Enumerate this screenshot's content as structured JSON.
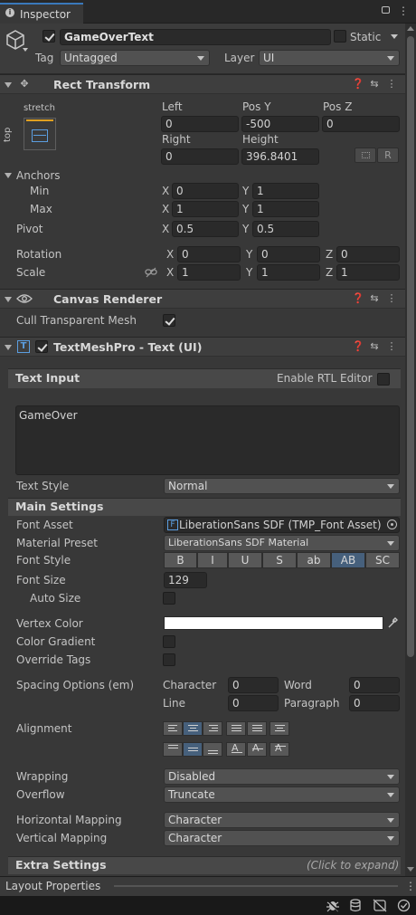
{
  "tab": {
    "label": "Inspector"
  },
  "object": {
    "name": "GameOverText",
    "static_label": "Static",
    "tag_label": "Tag",
    "tag_value": "Untagged",
    "layer_label": "Layer",
    "layer_value": "UI"
  },
  "rect_transform": {
    "title": "Rect Transform",
    "anchor_preset": {
      "h": "stretch",
      "v": "top"
    },
    "col_labels": {
      "left": "Left",
      "pos_y": "Pos Y",
      "pos_z": "Pos Z",
      "right": "Right",
      "height": "Height"
    },
    "values": {
      "left": "0",
      "pos_y": "-500",
      "pos_z": "0",
      "right": "0",
      "height": "396.8401"
    },
    "raw_btn": "R",
    "anchors_label": "Anchors",
    "min_label": "Min",
    "min_x": "0",
    "min_y": "1",
    "max_label": "Max",
    "max_x": "1",
    "max_y": "1",
    "pivot_label": "Pivot",
    "pivot_x": "0.5",
    "pivot_y": "0.5",
    "rotation_label": "Rotation",
    "rot_x": "0",
    "rot_y": "0",
    "rot_z": "0",
    "scale_label": "Scale",
    "scale_x": "1",
    "scale_y": "1",
    "scale_z": "1",
    "axis_x": "X",
    "axis_y": "Y",
    "axis_z": "Z"
  },
  "canvas_renderer": {
    "title": "Canvas Renderer",
    "cull_label": "Cull Transparent Mesh"
  },
  "tmp": {
    "title": "TextMeshPro - Text (UI)",
    "text_input_label": "Text Input",
    "rtl_label": "Enable RTL Editor",
    "text": "GameOver",
    "text_style_label": "Text Style",
    "text_style_value": "Normal",
    "main_settings": "Main Settings",
    "font_asset_label": "Font Asset",
    "font_asset_value": "LiberationSans SDF (TMP_Font Asset)",
    "material_label": "Material Preset",
    "material_value": "LiberationSans SDF Material",
    "font_style_label": "Font Style",
    "font_style_buttons": [
      "B",
      "I",
      "U",
      "S",
      "ab",
      "AB",
      "SC"
    ],
    "font_size_label": "Font Size",
    "font_size_value": "129",
    "auto_size_label": "Auto Size",
    "vertex_color_label": "Vertex Color",
    "color_gradient_label": "Color Gradient",
    "override_tags_label": "Override Tags",
    "spacing_label": "Spacing Options (em)",
    "character_label": "Character",
    "character_value": "0",
    "word_label": "Word",
    "word_value": "0",
    "line_label": "Line",
    "line_value": "0",
    "paragraph_label": "Paragraph",
    "paragraph_value": "0",
    "alignment_label": "Alignment",
    "wrapping_label": "Wrapping",
    "wrapping_value": "Disabled",
    "overflow_label": "Overflow",
    "overflow_value": "Truncate",
    "hmap_label": "Horizontal Mapping",
    "hmap_value": "Character",
    "vmap_label": "Vertical Mapping",
    "vmap_value": "Character",
    "extra_label": "Extra Settings",
    "extra_hint": "(Click to expand)"
  },
  "layout_properties": {
    "label": "Layout Properties"
  },
  "colors": {
    "vertex_color": "#ffffff",
    "accent": "#46607c",
    "bg": "#383838"
  }
}
